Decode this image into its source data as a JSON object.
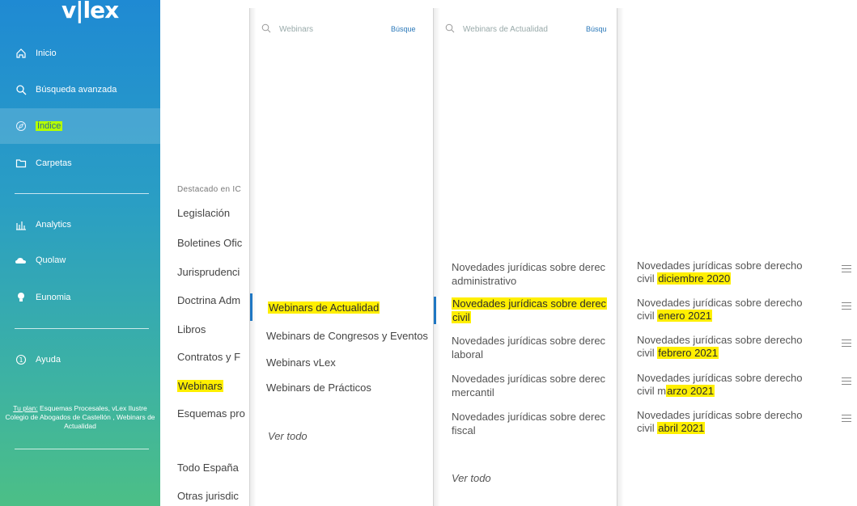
{
  "sidebar": {
    "logo": "v|lex",
    "items": [
      {
        "label": "Inicio",
        "icon": "home-icon"
      },
      {
        "label": "Búsqueda avanzada",
        "icon": "search-icon"
      },
      {
        "label": "Índice",
        "icon": "compass-icon"
      },
      {
        "label": "Carpetas",
        "icon": "folder-icon"
      },
      {
        "label": "Analytics",
        "icon": "bar-chart-icon"
      },
      {
        "label": "Quolaw",
        "icon": "cloud-icon"
      },
      {
        "label": "Eunomia",
        "icon": "bulb-icon"
      },
      {
        "label": "Ayuda",
        "icon": "help-icon"
      }
    ],
    "plan": {
      "prefix": "Tu plan:",
      "text": " Esquemas Procesales, vLex Ilustre Colegio de Abogados de Castellón , Webinars de Actualidad"
    }
  },
  "col1": {
    "heading": "Destacado en IC",
    "items": [
      "Legislación",
      "Boletines Ofic",
      "Jurisprudenci",
      "Doctrina Adm",
      "Libros",
      "Contratos y F",
      "Webinars",
      "Esquemas pro",
      "Todo España",
      "Otras jurisdic"
    ]
  },
  "col2": {
    "search": {
      "placeholder": "Webinars",
      "button": "Búsque"
    },
    "items": [
      "Webinars de Actualidad",
      "Webinars de Congresos y Eventos",
      "Webinars vLex",
      "Webinars de Prácticos"
    ],
    "ver_todo": "Ver todo"
  },
  "col3": {
    "search": {
      "placeholder": "Webinars de Actualidad",
      "button": "Búsqu"
    },
    "items": [
      {
        "line1": "Novedades jurídicas sobre derec",
        "line2": "administrativo"
      },
      {
        "line1": "Novedades jurídicas sobre derec",
        "line2": "civil"
      },
      {
        "line1": "Novedades jurídicas sobre derec",
        "line2": "laboral"
      },
      {
        "line1": "Novedades jurídicas sobre derec",
        "line2": "mercantil"
      },
      {
        "line1": "Novedades jurídicas sobre derec",
        "line2": "fiscal"
      }
    ],
    "ver_todo": "Ver todo"
  },
  "col4": {
    "items": [
      {
        "line1": "Novedades jurídicas sobre derecho",
        "prefix": "civil ",
        "date_plain": "",
        "date_hl": "diciembre 2020"
      },
      {
        "line1": "Novedades jurídicas sobre derecho",
        "prefix": "civil ",
        "date_plain": "",
        "date_hl": "enero 2021"
      },
      {
        "line1": "Novedades jurídicas sobre derecho",
        "prefix": "civil ",
        "date_plain": "",
        "date_hl": "febrero 2021"
      },
      {
        "line1": "Novedades jurídicas sobre derecho",
        "prefix": "civil ",
        "date_plain": "m",
        "date_hl": "arzo 2021"
      },
      {
        "line1": "Novedades jurídicas sobre derecho",
        "prefix": "civil ",
        "date_plain": "",
        "date_hl": "abril 2021"
      }
    ]
  },
  "colors": {
    "highlight": "#ffef00",
    "highlight_green": "#b4ff00",
    "selection_bar": "#1f77c3"
  }
}
